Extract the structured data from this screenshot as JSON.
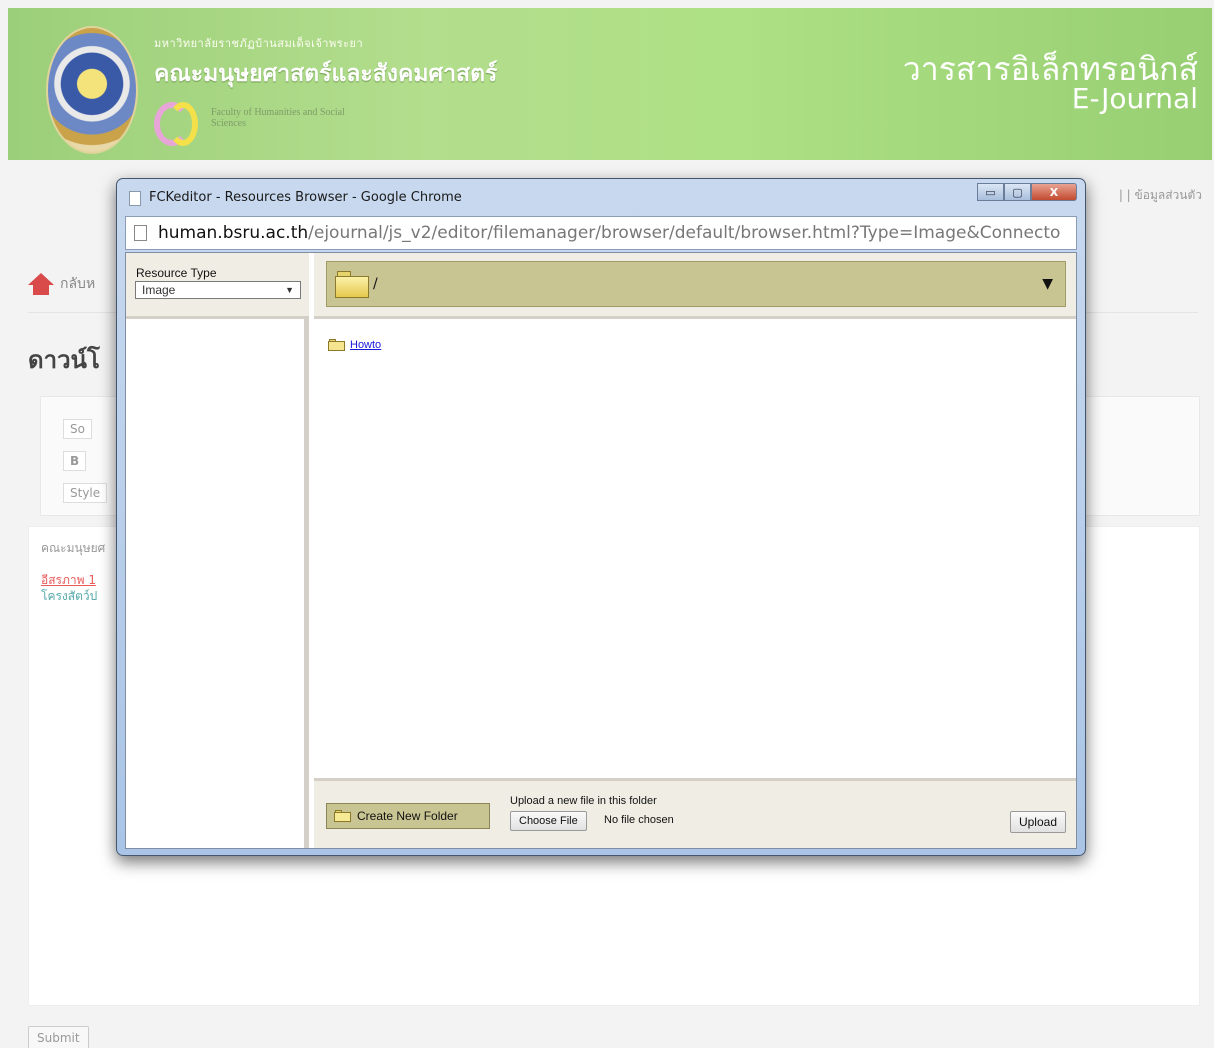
{
  "site": {
    "university_name": "มหาวิทยาลัยราชภัฏบ้านสมเด็จเจ้าพระยา",
    "faculty_name": "คณะมนุษยศาสตร์และสังคมศาสตร์",
    "faculty_name_en": "Faculty of Humanities and Social Sciences",
    "journal_th": "วารสารอิเล็กทรอนิกส์",
    "journal_en": "E-Journal",
    "top_links": "| | ข้อมูลส่วนตัว",
    "home_label": "กลับห",
    "page_heading": "ดาวน์โ",
    "toolbar_source": "So",
    "toolbar_bold": "B",
    "toolbar_style": "Style",
    "editor_line1": "คณะมนุษยศ",
    "editor_line2": "อีสรภาพ 1",
    "editor_line3": "โครงสัตว์ป",
    "submit_label": "Submit"
  },
  "popup": {
    "window_title": "FCKeditor - Resources Browser - Google Chrome",
    "window_controls": {
      "minimize": "▭",
      "maximize": "▢",
      "close": "X"
    },
    "url_host": "human.bsru.ac.th",
    "url_path": "/ejournal/js_v2/editor/filemanager/browser/default/browser.html?Type=Image&Connecto",
    "resource_type_label": "Resource Type",
    "resource_type_value": "Image",
    "dropdown_arrow": "▼",
    "current_path": "/",
    "folders": [
      "Howto"
    ],
    "create_folder_label": "Create New Folder",
    "upload_label": "Upload a new file in this folder",
    "choose_file_label": "Choose File",
    "no_file_label": "No file chosen",
    "upload_button_label": "Upload"
  }
}
